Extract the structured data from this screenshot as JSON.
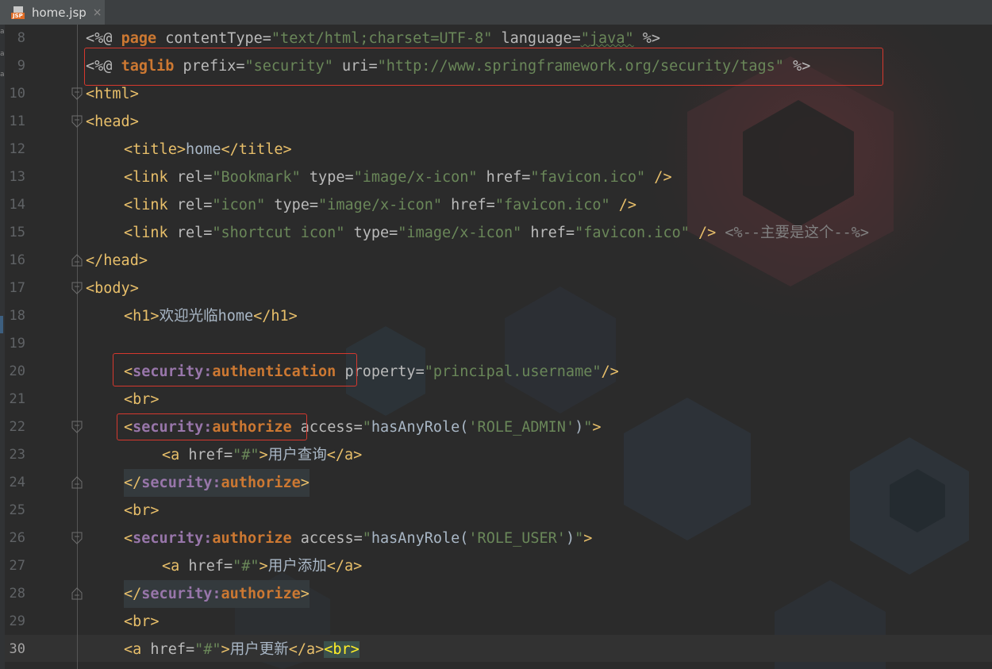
{
  "tab": {
    "label": "home.jsp",
    "icon": "jsp-file-icon",
    "badge": "JSP",
    "close": "×"
  },
  "editor": {
    "lines": [
      {
        "num": "8",
        "fold": "",
        "indent": 108,
        "tokens": [
          {
            "c": "a",
            "t": "<%@ "
          },
          {
            "c": "k",
            "t": "page "
          },
          {
            "c": "a",
            "t": "contentType="
          },
          {
            "c": "s",
            "t": "\"text/html;charset=UTF-8\""
          },
          {
            "c": "a",
            "t": " language="
          },
          {
            "c": "u",
            "t": "\"java\""
          },
          {
            "c": "a",
            "t": " %>"
          }
        ]
      },
      {
        "num": "9",
        "fold": "",
        "indent": 108,
        "tokens": [
          {
            "c": "a",
            "t": "<%@ "
          },
          {
            "c": "k",
            "t": "taglib "
          },
          {
            "c": "a",
            "t": "prefix="
          },
          {
            "c": "s",
            "t": "\"security\""
          },
          {
            "c": "a",
            "t": " uri="
          },
          {
            "c": "s",
            "t": "\"http://www.springframework.org/security/tags\""
          },
          {
            "c": "a",
            "t": " %>"
          }
        ]
      },
      {
        "num": "10",
        "fold": "open",
        "indent": 108,
        "tokens": [
          {
            "c": "t",
            "t": "<html>"
          }
        ]
      },
      {
        "num": "11",
        "fold": "open",
        "indent": 108,
        "tokens": [
          {
            "c": "t",
            "t": "<head>"
          }
        ]
      },
      {
        "num": "12",
        "fold": "",
        "indent": 156,
        "tokens": [
          {
            "c": "t",
            "t": "<title>"
          },
          {
            "c": "tx",
            "t": "home"
          },
          {
            "c": "t",
            "t": "</title>"
          }
        ]
      },
      {
        "num": "13",
        "fold": "",
        "indent": 156,
        "tokens": [
          {
            "c": "t",
            "t": "<link "
          },
          {
            "c": "a",
            "t": "rel="
          },
          {
            "c": "s",
            "t": "\"Bookmark\""
          },
          {
            "c": "a",
            "t": " type="
          },
          {
            "c": "s",
            "t": "\"image/x-icon\""
          },
          {
            "c": "a",
            "t": " href="
          },
          {
            "c": "s",
            "t": "\"favicon.ico\""
          },
          {
            "c": "t",
            "t": " />"
          }
        ]
      },
      {
        "num": "14",
        "fold": "",
        "indent": 156,
        "tokens": [
          {
            "c": "t",
            "t": "<link "
          },
          {
            "c": "a",
            "t": "rel="
          },
          {
            "c": "s",
            "t": "\"icon\""
          },
          {
            "c": "a",
            "t": " type="
          },
          {
            "c": "s",
            "t": "\"image/x-icon\""
          },
          {
            "c": "a",
            "t": " href="
          },
          {
            "c": "s",
            "t": "\"favicon.ico\""
          },
          {
            "c": "t",
            "t": " />"
          }
        ]
      },
      {
        "num": "15",
        "fold": "",
        "indent": 156,
        "tokens": [
          {
            "c": "t",
            "t": "<link "
          },
          {
            "c": "a",
            "t": "rel="
          },
          {
            "c": "s",
            "t": "\"shortcut icon\""
          },
          {
            "c": "a",
            "t": " type="
          },
          {
            "c": "s",
            "t": "\"image/x-icon\""
          },
          {
            "c": "a",
            "t": " href="
          },
          {
            "c": "s",
            "t": "\"favicon.ico\""
          },
          {
            "c": "t",
            "t": " /> "
          },
          {
            "c": "c",
            "t": "<%--主要是这个--%>"
          }
        ]
      },
      {
        "num": "16",
        "fold": "close",
        "indent": 108,
        "tokens": [
          {
            "c": "t",
            "t": "</head>"
          }
        ]
      },
      {
        "num": "17",
        "fold": "open",
        "indent": 108,
        "tokens": [
          {
            "c": "t",
            "t": "<body>"
          }
        ]
      },
      {
        "num": "18",
        "fold": "",
        "indent": 156,
        "tokens": [
          {
            "c": "t",
            "t": "<h1>"
          },
          {
            "c": "tx",
            "t": "欢迎光临home"
          },
          {
            "c": "t",
            "t": "</h1>"
          }
        ]
      },
      {
        "num": "19",
        "fold": "",
        "indent": 156,
        "tokens": []
      },
      {
        "num": "20",
        "fold": "",
        "indent": 156,
        "tokens": [
          {
            "c": "t",
            "t": "<"
          },
          {
            "c": "ns",
            "t": "security:"
          },
          {
            "c": "nm",
            "t": "authentication"
          },
          {
            "c": "a",
            "t": " property="
          },
          {
            "c": "s",
            "t": "\"principal.username\""
          },
          {
            "c": "t",
            "t": "/>"
          }
        ]
      },
      {
        "num": "21",
        "fold": "",
        "indent": 156,
        "tokens": [
          {
            "c": "t",
            "t": "<br>"
          }
        ]
      },
      {
        "num": "22",
        "fold": "open",
        "indent": 156,
        "tokens": [
          {
            "c": "t",
            "t": "<"
          },
          {
            "c": "ns",
            "t": "security:"
          },
          {
            "c": "nm",
            "t": "authorize"
          },
          {
            "c": "a",
            "t": " access="
          },
          {
            "c": "s",
            "t": "\""
          },
          {
            "c": "tx",
            "t": "hasAnyRole("
          },
          {
            "c": "s",
            "t": "'ROLE_ADMIN'"
          },
          {
            "c": "tx",
            "t": ")"
          },
          {
            "c": "s",
            "t": "\""
          },
          {
            "c": "t",
            "t": ">"
          }
        ]
      },
      {
        "num": "23",
        "fold": "",
        "indent": 204,
        "tokens": [
          {
            "c": "t",
            "t": "<a "
          },
          {
            "c": "a",
            "t": "href="
          },
          {
            "c": "s",
            "t": "\"#\""
          },
          {
            "c": "t",
            "t": ">"
          },
          {
            "c": "tx",
            "t": "用户查询"
          },
          {
            "c": "t",
            "t": "</a>"
          }
        ]
      },
      {
        "num": "24",
        "fold": "close",
        "indent": 156,
        "hl": true,
        "tokens": [
          {
            "c": "t",
            "t": "</"
          },
          {
            "c": "ns",
            "t": "security:"
          },
          {
            "c": "nm",
            "t": "authorize"
          },
          {
            "c": "t",
            "t": ">"
          }
        ]
      },
      {
        "num": "25",
        "fold": "",
        "indent": 156,
        "tokens": [
          {
            "c": "t",
            "t": "<br>"
          }
        ]
      },
      {
        "num": "26",
        "fold": "open",
        "indent": 156,
        "tokens": [
          {
            "c": "t",
            "t": "<"
          },
          {
            "c": "ns",
            "t": "security:"
          },
          {
            "c": "nm",
            "t": "authorize"
          },
          {
            "c": "a",
            "t": " access="
          },
          {
            "c": "s",
            "t": "\""
          },
          {
            "c": "tx",
            "t": "hasAnyRole("
          },
          {
            "c": "s",
            "t": "'ROLE_USER'"
          },
          {
            "c": "tx",
            "t": ")"
          },
          {
            "c": "s",
            "t": "\""
          },
          {
            "c": "t",
            "t": ">"
          }
        ]
      },
      {
        "num": "27",
        "fold": "",
        "indent": 204,
        "tokens": [
          {
            "c": "t",
            "t": "<a "
          },
          {
            "c": "a",
            "t": "href="
          },
          {
            "c": "s",
            "t": "\"#\""
          },
          {
            "c": "t",
            "t": ">"
          },
          {
            "c": "tx",
            "t": "用户添加"
          },
          {
            "c": "t",
            "t": "</a>"
          }
        ]
      },
      {
        "num": "28",
        "fold": "close",
        "indent": 156,
        "hl": true,
        "tokens": [
          {
            "c": "t",
            "t": "</"
          },
          {
            "c": "ns",
            "t": "security:"
          },
          {
            "c": "nm",
            "t": "authorize"
          },
          {
            "c": "t",
            "t": ">"
          }
        ]
      },
      {
        "num": "29",
        "fold": "",
        "indent": 156,
        "tokens": [
          {
            "c": "t",
            "t": "<br>"
          }
        ]
      },
      {
        "num": "30",
        "fold": "",
        "indent": 156,
        "current": true,
        "tokens": [
          {
            "c": "t",
            "t": "<a "
          },
          {
            "c": "a",
            "t": "href="
          },
          {
            "c": "s",
            "t": "\"#\""
          },
          {
            "c": "t",
            "t": ">"
          },
          {
            "c": "tx",
            "t": "用户更新"
          },
          {
            "c": "t",
            "t": "</a>"
          },
          {
            "c": "match",
            "t": "<br>"
          }
        ]
      }
    ]
  }
}
